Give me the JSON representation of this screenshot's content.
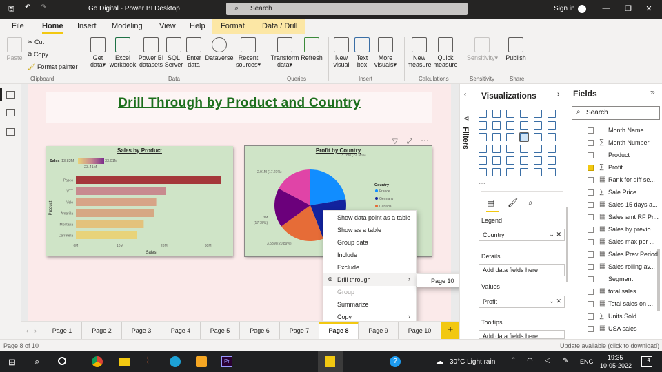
{
  "window": {
    "title": "Go Digital - Power BI Desktop",
    "search_placeholder": "Search",
    "signin": "Sign in"
  },
  "ribbon_tabs": [
    "File",
    "Home",
    "Insert",
    "Modeling",
    "View",
    "Help",
    "Format",
    "Data / Drill"
  ],
  "ribbon": {
    "paste": "Paste",
    "cut": "Cut",
    "copy": "Copy",
    "format_painter": "Format painter",
    "get_data": [
      "Get",
      "data"
    ],
    "excel": [
      "Excel",
      "workbook"
    ],
    "datasets": [
      "Power BI",
      "datasets"
    ],
    "sql": [
      "SQL",
      "Server"
    ],
    "enter": [
      "Enter",
      "data"
    ],
    "dataverse": [
      "Dataverse",
      ""
    ],
    "recent": [
      "Recent",
      "sources"
    ],
    "transform": [
      "Transform",
      "data"
    ],
    "refresh": [
      "Refresh",
      ""
    ],
    "new_visual": [
      "New",
      "visual"
    ],
    "text_box": [
      "Text",
      "box"
    ],
    "more_visuals": [
      "More",
      "visuals"
    ],
    "new_measure": [
      "New",
      "measure"
    ],
    "quick_measure": [
      "Quick",
      "measure"
    ],
    "sensitivity": [
      "Sensitivity",
      ""
    ],
    "publish": [
      "Publish",
      ""
    ],
    "groups": {
      "clipboard": "Clipboard",
      "data": "Data",
      "queries": "Queries",
      "insert": "Insert",
      "calculations": "Calculations",
      "sensitivity": "Sensitivity",
      "share": "Share"
    }
  },
  "page_title": "Drill Through by Product and Country",
  "bar_visual": {
    "title": "Sales by Product",
    "legend_label": "Sales",
    "legend_min": "13.82M",
    "legend_max": "33.01M",
    "legend_mid": "23.41M",
    "ylabel": "Product",
    "xlabel": "Sales",
    "xticks": [
      "0M",
      "10M",
      "20M",
      "30M"
    ]
  },
  "pie_visual": {
    "title": "Profit by Country",
    "legend_title": "Country",
    "labels": [
      "3.78M (22.38%)",
      "2.91M (17.21%)",
      "3M (17.75%)",
      "3.53M (20.89%)"
    ]
  },
  "chart_data": [
    {
      "type": "bar",
      "title": "Sales by Product",
      "xlabel": "Sales",
      "ylabel": "Product",
      "categories": [
        "Paseo",
        "VTT",
        "Velo",
        "Amarilla",
        "Montana",
        "Carretera"
      ],
      "values": [
        33.01,
        20.5,
        18.25,
        17.75,
        15.4,
        13.82
      ],
      "xlim": [
        0,
        35
      ],
      "unit": "M",
      "colors": [
        "#a4373a",
        "#c88a8f",
        "#d7a487",
        "#d6a884",
        "#e3c27c",
        "#e8d37a"
      ]
    },
    {
      "type": "pie",
      "title": "Profit by Country",
      "slices": [
        {
          "name": "France",
          "value": 3.78,
          "color": "#118dff"
        },
        {
          "name": "Germany",
          "value": 3.68,
          "color": "#12239e"
        },
        {
          "name": "Canada",
          "value": 3.53,
          "color": "#e66c37"
        },
        {
          "name": "",
          "value": 3.0,
          "color": "#6b007b"
        },
        {
          "name": "",
          "value": 2.91,
          "color": "#e044a7"
        }
      ]
    }
  ],
  "context_menu": {
    "items": [
      "Show data point as a table",
      "Show as a table",
      "Group data",
      "Include",
      "Exclude",
      "Drill through",
      "Group",
      "Summarize",
      "Copy"
    ],
    "submenu": "Page 10"
  },
  "pane": {
    "filters": "Filters",
    "visualizations": "Visualizations",
    "fields": "Fields",
    "search": "Search",
    "legend": "Legend",
    "legend_value": "Country",
    "details": "Details",
    "details_placeholder": "Add data fields here",
    "values": "Values",
    "values_value": "Profit",
    "tooltips": "Tooltips",
    "tooltips_placeholder": "Add data fields here"
  },
  "field_list": [
    {
      "name": "Month Name",
      "type": "",
      "checked": false
    },
    {
      "name": "Month Number",
      "type": "∑",
      "checked": false
    },
    {
      "name": "Product",
      "type": "",
      "checked": false
    },
    {
      "name": "Profit",
      "type": "∑",
      "checked": true
    },
    {
      "name": "Rank for diff se...",
      "type": "▦",
      "checked": false
    },
    {
      "name": "Sale Price",
      "type": "∑",
      "checked": false
    },
    {
      "name": "Sales 15 days a...",
      "type": "▦",
      "checked": false
    },
    {
      "name": "Sales amt RF Pr...",
      "type": "▦",
      "checked": false
    },
    {
      "name": "Sales by previo...",
      "type": "▦",
      "checked": false
    },
    {
      "name": "Sales max per ...",
      "type": "▦",
      "checked": false
    },
    {
      "name": "Sales Prev Period",
      "type": "▦",
      "checked": false
    },
    {
      "name": "Sales rolling av...",
      "type": "▦",
      "checked": false
    },
    {
      "name": "Segment",
      "type": "",
      "checked": false
    },
    {
      "name": "total sales",
      "type": "▦",
      "checked": false
    },
    {
      "name": "Total sales on ...",
      "type": "▦",
      "checked": false
    },
    {
      "name": "Units Sold",
      "type": "∑",
      "checked": false
    },
    {
      "name": "USA sales",
      "type": "▦",
      "checked": false
    }
  ],
  "pages": [
    "Page 1",
    "Page 2",
    "Page 3",
    "Page 4",
    "Page 5",
    "Page 6",
    "Page 7",
    "Page 8",
    "Page 9",
    "Page 10"
  ],
  "active_page": "Page 8",
  "status": {
    "left": "Page 8 of 10",
    "right": "Update available (click to download)"
  },
  "taskbar": {
    "weather": "30°C  Light rain",
    "lang": "ENG",
    "time": "19:35",
    "date": "10-05-2022",
    "notif": "4"
  }
}
